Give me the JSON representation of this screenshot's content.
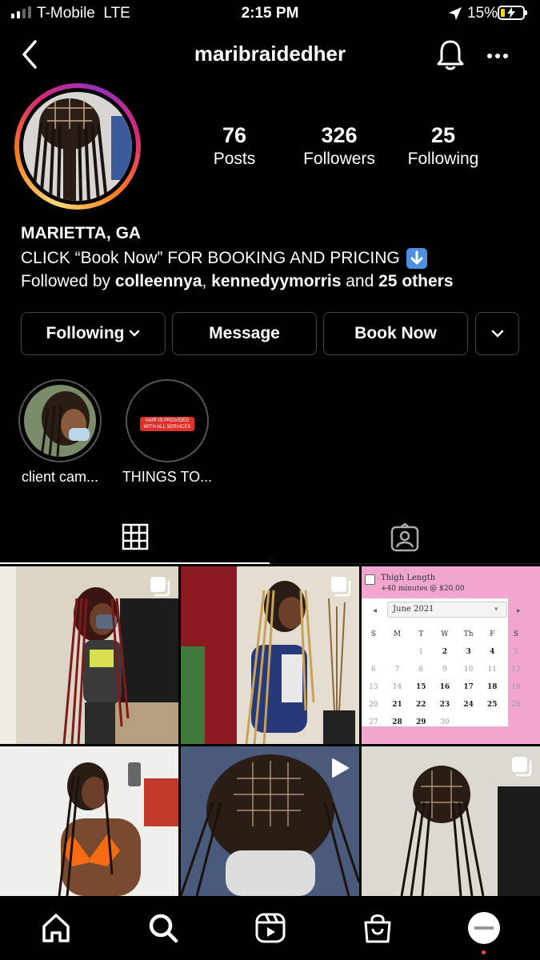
{
  "status_bar": {
    "carrier": "T-Mobile",
    "network": "LTE",
    "time": "2:15 PM",
    "battery": "15%"
  },
  "header": {
    "username": "maribraidedher"
  },
  "stats": [
    {
      "value": "76",
      "label": "Posts"
    },
    {
      "value": "326",
      "label": "Followers"
    },
    {
      "value": "25",
      "label": "Following"
    }
  ],
  "bio": {
    "name": "MARIETTA, GA",
    "line": "CLICK “Book Now” FOR BOOKING AND PRICING",
    "followed_by_prefix": "Followed by",
    "follower1": "colleennya",
    "follower2": "kennedyymorris",
    "and": "and",
    "others": "25 others"
  },
  "buttons": {
    "following": "Following",
    "message": "Message",
    "book_now": "Book Now"
  },
  "highlights": [
    {
      "label": "client cam..."
    },
    {
      "label": "THINGS TO...",
      "badge_text": "HAIR IS PROVIDED WITH ALL SERVICES"
    }
  ],
  "calendar_post": {
    "option": "Thigh Length",
    "price_line": "+40 minutes @ $20.00",
    "month": "June 2021",
    "weekdays": [
      "S",
      "M",
      "T",
      "W",
      "Th",
      "F",
      "S"
    ],
    "weeks": [
      [
        "",
        "",
        "1",
        "2",
        "3",
        "4",
        "5"
      ],
      [
        "6",
        "7",
        "8",
        "9",
        "10",
        "11",
        "12"
      ],
      [
        "13",
        "14",
        "15",
        "16",
        "17",
        "18",
        "19"
      ],
      [
        "20",
        "21",
        "22",
        "23",
        "24",
        "25",
        "26"
      ],
      [
        "27",
        "28",
        "29",
        "30",
        "",
        "",
        ""
      ]
    ],
    "available_days": [
      "2",
      "3",
      "4",
      "15",
      "16",
      "17",
      "18",
      "21",
      "22",
      "23",
      "24",
      "25",
      "28",
      "29"
    ]
  },
  "colors": {
    "background": "#000000",
    "button_border": "#444444",
    "calendar_pink": "#f0a6cf",
    "notification_dot": "#ed4956"
  }
}
